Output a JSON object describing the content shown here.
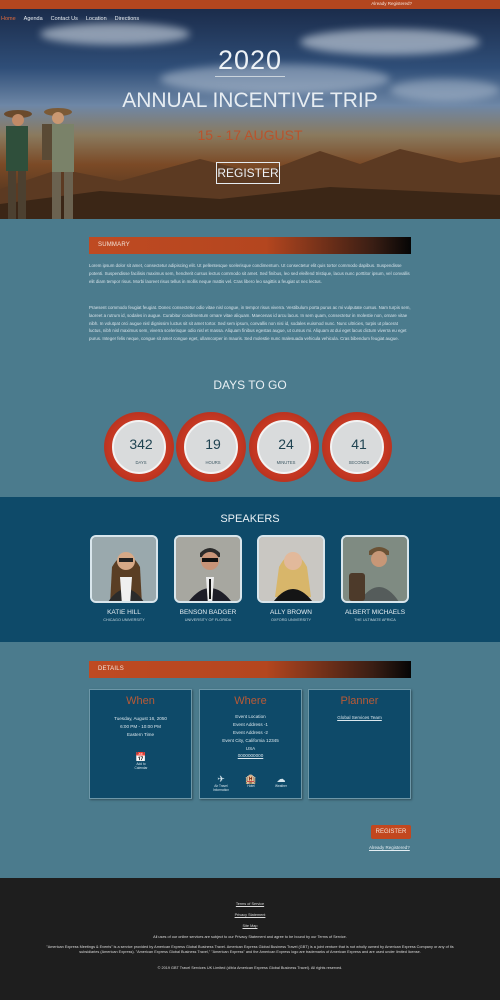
{
  "top_bar": {
    "already_registered": "Already Registered?"
  },
  "nav": [
    "Home",
    "Agenda",
    "Contact Us",
    "Location",
    "Directions"
  ],
  "hero": {
    "year": "2020",
    "title": "ANNUAL INCENTIVE TRIP",
    "dates": "15 - 17 AUGUST",
    "register_label": "REGISTER"
  },
  "summary": {
    "title": "SUMMARY",
    "paragraphs": [
      "Lorem ipsum dolor sit amet, consectetur adipiscing elit. Ut pellentesque scelerisque condimentum. Ut consectetur elit quis tortor commodo dapibus. Suspendisse potenti. Suspendisse facilisis maximus sem, hendrerit cursus lectus commodo sit amet. Sed finibus, leo sed eleifend tristique, lacus nunc porttitor ipsum, vel convallis elit diam tempor risus. Morbi laoreet risus tellus in mollis neque mattis vel. Cras libero leo sagittis a feugiat ut nec lectus.",
      "Praesent commodo feugiat feugiat. Donec consectetur odio vitae nisl congue, in tempor risus viverra. Vestibulum porta purus ac mi vulputate cursus. Nam turpis sem, laoreet a rutrum id, sodales in augue. Curabitur condimentum ornare vitae aliquam. Maecenas id arcu lacus. In sem quam, consectetur in molestie non, ornare vitae nibh. In volutpat orci augue nisl dignissim luctus sit sit amet tortor. Sed sem ipsum, convallis non nisi id, sodales euismod nunc. Nunc ultricies, turpis ut placerat luctus, nibh nisl maximus sem, viverra scelerisque odio nisl et massa. Aliquam finibus egestas augue, ut cursus mi. Aliquam at dui eget lacus dictum viverra eu eget purus. Integer felis neque, congue sit amet congue eget, ullamcorper in mauris. Sed molestie nunc malesuada vehicula vehicula. Cras bibendum feugiat augue."
    ]
  },
  "countdown": {
    "title": "DAYS TO GO",
    "items": [
      {
        "value": "342",
        "label": "DAYS"
      },
      {
        "value": "19",
        "label": "HOURS"
      },
      {
        "value": "24",
        "label": "MINUTES"
      },
      {
        "value": "41",
        "label": "SECONDS"
      }
    ]
  },
  "speakers": {
    "title": "SPEAKERS",
    "items": [
      {
        "name": "KATIE HILL",
        "org": "CHICAGO UNIVERSITY"
      },
      {
        "name": "BENSON BADGER",
        "org": "UNIVERSITY OF FLORIDA"
      },
      {
        "name": "ALLY BROWN",
        "org": "OXFORD UNIVERSITY"
      },
      {
        "name": "ALBERT MICHAELS",
        "org": "THE ULTIMATE AFRICA"
      }
    ]
  },
  "details": {
    "title": "DETAILS",
    "when": {
      "heading": "When",
      "lines": [
        "Tuesday, August 16, 2050",
        "6:00 PM - 10:00 PM",
        "Eastern Time"
      ],
      "add_calendar": "Add to Calendar"
    },
    "where": {
      "heading": "Where",
      "lines": [
        "Event Location",
        "Event Address -1",
        "Event Address -2",
        "Event City, California 12345",
        "USA"
      ],
      "phone": "0000000000",
      "icons": [
        {
          "icon": "plane-icon",
          "label": "Air Travel Information"
        },
        {
          "icon": "hotel-icon",
          "label": "Hotel"
        },
        {
          "icon": "weather-icon",
          "label": "Weather"
        }
      ]
    },
    "planner": {
      "heading": "Planner",
      "contact": "Global Services Team"
    }
  },
  "register2": {
    "button": "REGISTER",
    "already": "Already Registered?"
  },
  "footer": {
    "links": [
      "Terms of Service",
      "Privacy Statement",
      "Site Map"
    ],
    "line1": "All uses of our online services are subject to our Privacy Statement and agree to be bound by our Terms of Service.",
    "line2": "\"American Express Meetings & Events\" is a service provided by American Express Global Business Travel. American Express Global Business Travel (GBT) is a joint venture that is not wholly owned by American Express Company or any of its subsidiaries (American Express). \"American Express Global Business Travel,\" \"American Express\" and the American Express logo are trademarks of American Express and are used under limited license.",
    "line3": "© 2019 GBT Travel Services UK Limited (d/b/a American Express Global Business Travel). All rights reserved."
  }
}
